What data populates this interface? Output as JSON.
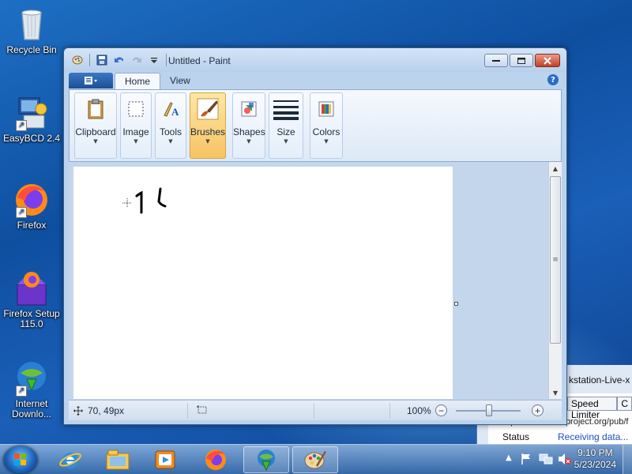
{
  "desktop": {
    "icons": [
      {
        "label": "Recycle Bin",
        "icon": "recycle-bin-icon"
      },
      {
        "label": "EasyBCD 2.4",
        "icon": "easybcd-icon"
      },
      {
        "label": "Firefox",
        "icon": "firefox-icon"
      },
      {
        "label": "Firefox Setup 115.0",
        "line1": "Firefox Setup",
        "line2": "115.0",
        "icon": "firefox-setup-icon"
      },
      {
        "label": "Internet Downlo...",
        "line1": "Internet",
        "line2": "Downlo...",
        "icon": "internet-download-manager-icon"
      }
    ]
  },
  "paint": {
    "title": "Untitled - Paint",
    "qat": [
      "paint-app-icon",
      "save-icon",
      "undo-icon",
      "redo-icon",
      "customize-qat-icon"
    ],
    "tabs": [
      {
        "label": "Home",
        "active": true
      },
      {
        "label": "View",
        "active": false
      }
    ],
    "ribbon_groups": [
      {
        "label": "Clipboard",
        "icon": "clipboard-icon"
      },
      {
        "label": "Image",
        "icon": "select-icon"
      },
      {
        "label": "Tools",
        "icon": "tools-icon"
      },
      {
        "label": "Brushes",
        "icon": "brush-icon",
        "selected": true
      },
      {
        "label": "Shapes",
        "icon": "shapes-icon"
      },
      {
        "label": "Size",
        "icon": "size-icon"
      },
      {
        "label": "Colors",
        "icon": "colors-icon"
      }
    ],
    "status": {
      "cursor_pos": "70, 49px",
      "zoom": "100%",
      "zoom_level": 1.0
    }
  },
  "background_window": {
    "title": "kstation-Live-x",
    "tab_speed_limiter": "Speed Limiter",
    "tab_partial": "C",
    "url": "https://dl.ubuntu-project.org/pub/f",
    "status_label": "Status",
    "status_value": "Receiving data..."
  },
  "taskbar": {
    "items": [
      {
        "name": "internet-explorer-icon",
        "open": false
      },
      {
        "name": "file-explorer-icon",
        "open": false
      },
      {
        "name": "media-player-icon",
        "open": false
      },
      {
        "name": "firefox-icon",
        "open": false
      },
      {
        "name": "internet-download-manager-icon",
        "open": true
      },
      {
        "name": "paint-icon",
        "open": true
      }
    ],
    "time": "9:10 PM",
    "date": "5/23/2024"
  },
  "colors": {
    "accent": "#1a5fb8",
    "ribbon_selected": "#f7c363",
    "close_button": "#c0422a",
    "status_link": "#1f4fbf"
  }
}
